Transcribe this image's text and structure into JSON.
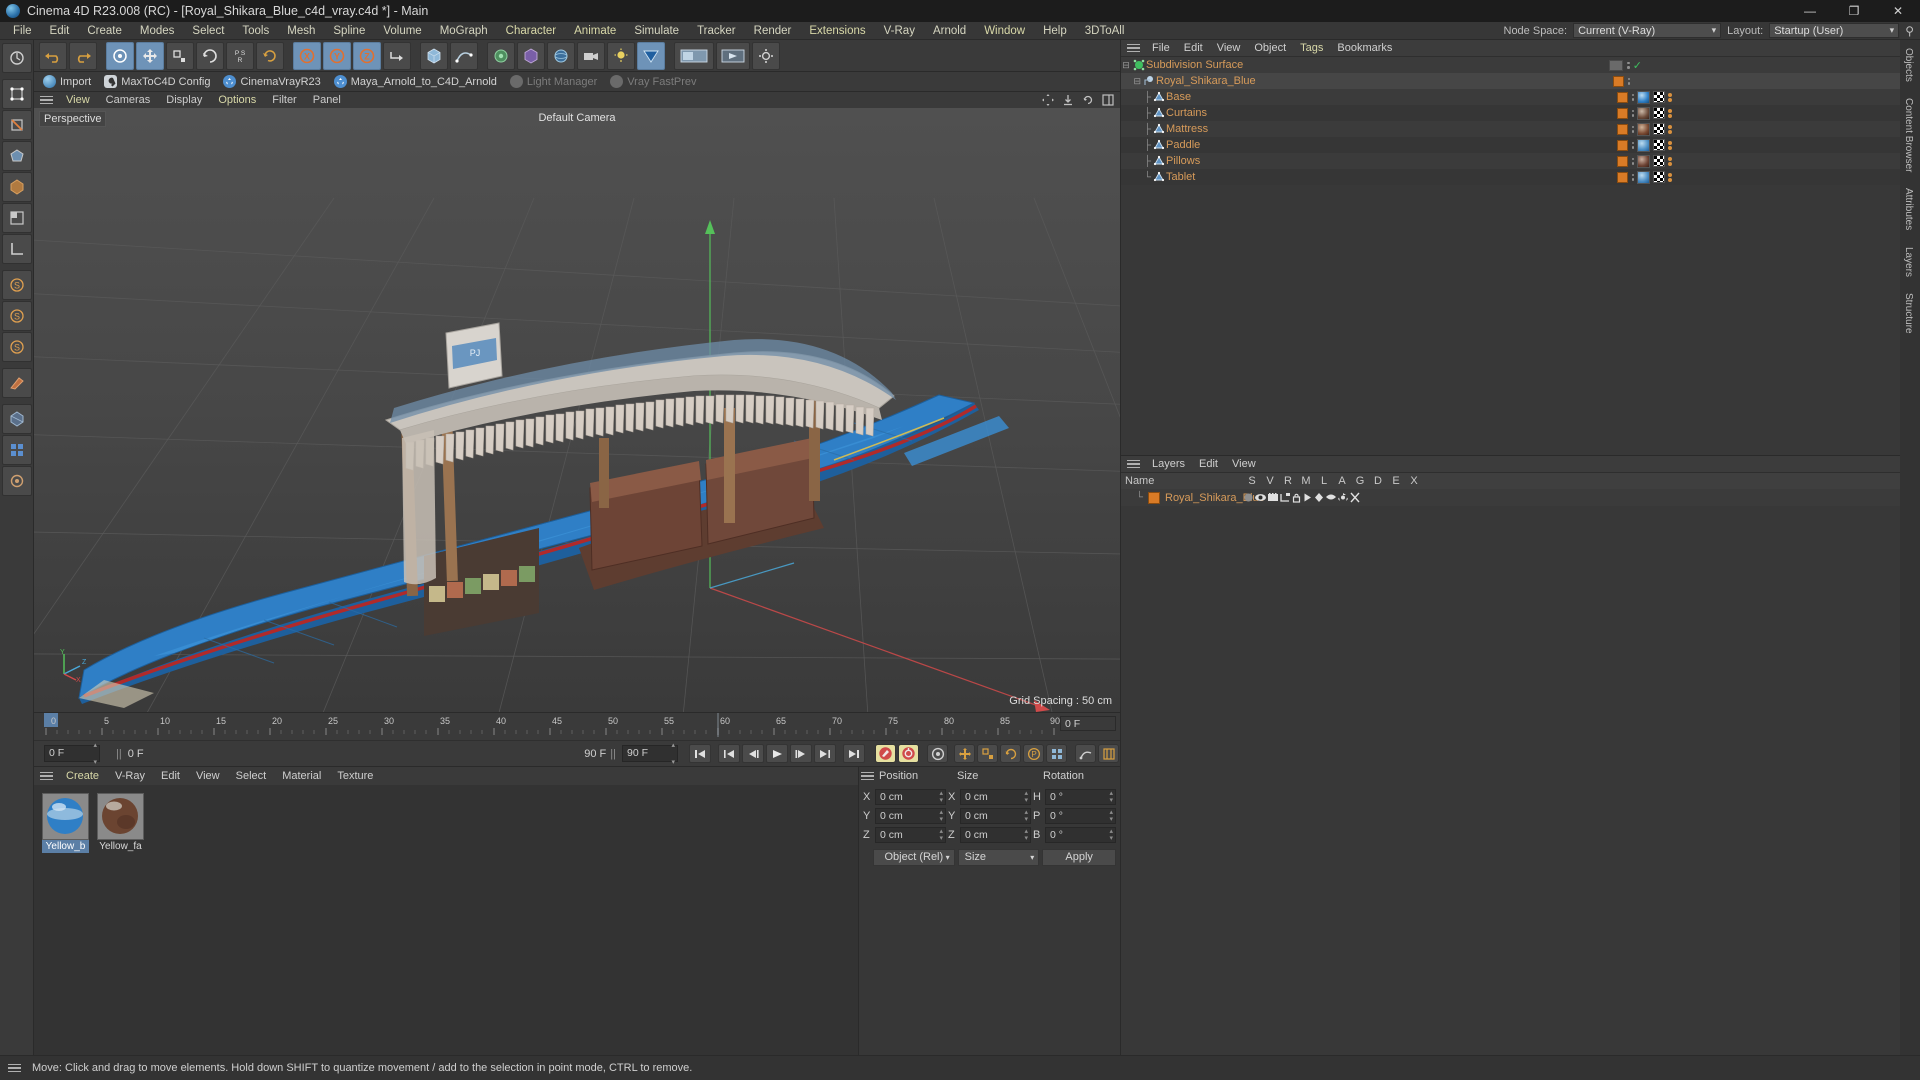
{
  "window": {
    "title": "Cinema 4D R23.008 (RC) - [Royal_Shikara_Blue_c4d_vray.c4d *] - Main",
    "minimize": "—",
    "maximize": "❐",
    "close": "✕"
  },
  "menu": {
    "items": [
      "File",
      "Edit",
      "Create",
      "Modes",
      "Select",
      "Tools",
      "Mesh",
      "Spline",
      "Volume",
      "MoGraph",
      "Character",
      "Animate",
      "Simulate",
      "Tracker",
      "Render",
      "Extensions",
      "V-Ray",
      "Arnold",
      "Window",
      "Help",
      "3DToAll"
    ],
    "node_space_label": "Node Space:",
    "node_space_value": "Current (V-Ray)",
    "layout_label": "Layout:",
    "layout_value": "Startup (User)"
  },
  "plugin_bar": {
    "items": [
      {
        "label": "Import",
        "dim": false,
        "color": "#5b9fd4"
      },
      {
        "label": "MaxToC4D Config",
        "dim": false,
        "color": "#cfd4d8"
      },
      {
        "label": "CinemaVrayR23",
        "dim": false,
        "color": "#4e8fd0"
      },
      {
        "label": "Maya_Arnold_to_C4D_Arnold",
        "dim": false,
        "color": "#4e8fd0"
      },
      {
        "label": "Light Manager",
        "dim": true,
        "color": "#6a6a6a"
      },
      {
        "label": "Vray FastPrev",
        "dim": true,
        "color": "#6a6a6a"
      }
    ]
  },
  "viewport": {
    "menu": [
      "View",
      "Cameras",
      "Display",
      "Options",
      "Filter",
      "Panel"
    ],
    "perspective_label": "Perspective",
    "camera_label": "Default Camera",
    "grid_spacing": "Grid Spacing : 50 cm",
    "axis_x": "X",
    "axis_y": "Y",
    "axis_z": "Z"
  },
  "timeline": {
    "ticks": [
      "0",
      "5",
      "10",
      "15",
      "20",
      "25",
      "30",
      "35",
      "40",
      "45",
      "50",
      "55",
      "60",
      "65",
      "70",
      "75",
      "80",
      "85",
      "90"
    ],
    "current_frame_label": "0 F",
    "start_frame": "0 F",
    "preview_start": "0 F",
    "end_frame": "90 F",
    "preview_end": "90 F"
  },
  "transport": {
    "buttons": [
      "go-to-start",
      "previous-key",
      "previous-frame",
      "play",
      "next-frame",
      "next-key",
      "go-to-end"
    ],
    "record_tools": [
      "record-active-objects",
      "autokeying",
      "record-position",
      "record-scale",
      "record-rotation",
      "record-parameter",
      "keyframe-selection",
      "point-level-animation",
      "animation-mode"
    ]
  },
  "material_manager": {
    "menu": [
      "Create",
      "V-Ray",
      "Edit",
      "View",
      "Select",
      "Material",
      "Texture"
    ],
    "materials": [
      {
        "name": "Yellow_b",
        "selected": true
      },
      {
        "name": "Yellow_fa",
        "selected": false
      }
    ]
  },
  "object_manager": {
    "menu": [
      "File",
      "Edit",
      "View",
      "Object",
      "Tags",
      "Bookmarks"
    ],
    "rows": [
      {
        "name": "Subdivision Surface",
        "depth": 0,
        "icon": "subdivision-surface-icon",
        "selected": false,
        "has_tag": false,
        "has_check": true
      },
      {
        "name": "Royal_Shikara_Blue",
        "depth": 1,
        "icon": "null-object-icon",
        "selected": true,
        "has_tag": true,
        "has_check": false
      },
      {
        "name": "Base",
        "depth": 2,
        "icon": "polygon-object-icon",
        "selected": false,
        "has_tag": true,
        "material": "#5b9fd4"
      },
      {
        "name": "Curtains",
        "depth": 2,
        "icon": "polygon-object-icon",
        "selected": false,
        "has_tag": true,
        "material": "#6b4b3a"
      },
      {
        "name": "Mattress",
        "depth": 2,
        "icon": "polygon-object-icon",
        "selected": false,
        "has_tag": true,
        "material": "#7a4a32"
      },
      {
        "name": "Paddle",
        "depth": 2,
        "icon": "polygon-object-icon",
        "selected": false,
        "has_tag": true,
        "material": "#4d8fc4"
      },
      {
        "name": "Pillows",
        "depth": 2,
        "icon": "polygon-object-icon",
        "selected": false,
        "has_tag": true,
        "material": "#6d4334"
      },
      {
        "name": "Tablet",
        "depth": 2,
        "icon": "polygon-object-icon",
        "selected": false,
        "has_tag": true,
        "material": "#4a8bc2"
      }
    ]
  },
  "layers_manager": {
    "menu": [
      "Layers",
      "Edit",
      "View"
    ],
    "name_header": "Name",
    "columns": [
      "S",
      "V",
      "R",
      "M",
      "L",
      "A",
      "G",
      "D",
      "E",
      "X"
    ],
    "rows": [
      {
        "name": "Royal_Shikara_Blue",
        "color": "#d97b26"
      }
    ]
  },
  "coordinates": {
    "position_label": "Position",
    "size_label": "Size",
    "rotation_label": "Rotation",
    "position": {
      "x": "0 cm",
      "y": "0 cm",
      "z": "0 cm"
    },
    "size": {
      "x": "0 cm",
      "y": "0 cm",
      "z": "0 cm"
    },
    "rotation": {
      "h": "0 °",
      "p": "0 °",
      "b": "0 °"
    },
    "axis_labels": {
      "x": "X",
      "y": "Y",
      "z": "Z",
      "h": "H",
      "p": "P",
      "b": "B"
    },
    "mode_dropdown": "Object (Rel)",
    "size_dropdown": "Size",
    "apply_button": "Apply"
  },
  "right_tabs": [
    "Objects",
    "Content Browser",
    "Attributes",
    "Layers",
    "Structure"
  ],
  "status": {
    "text": "Move: Click and drag to move elements. Hold down SHIFT to quantize movement / add to the selection in point mode, CTRL to remove."
  },
  "colors": {
    "accent_orange": "#d79b26",
    "object_text": "#d79b5a",
    "menu_accent": "#d8d8a8",
    "tag_orange": "#d97b26",
    "select_blue": "#5b7fa6",
    "boat_blue": "#2e7fc4"
  }
}
